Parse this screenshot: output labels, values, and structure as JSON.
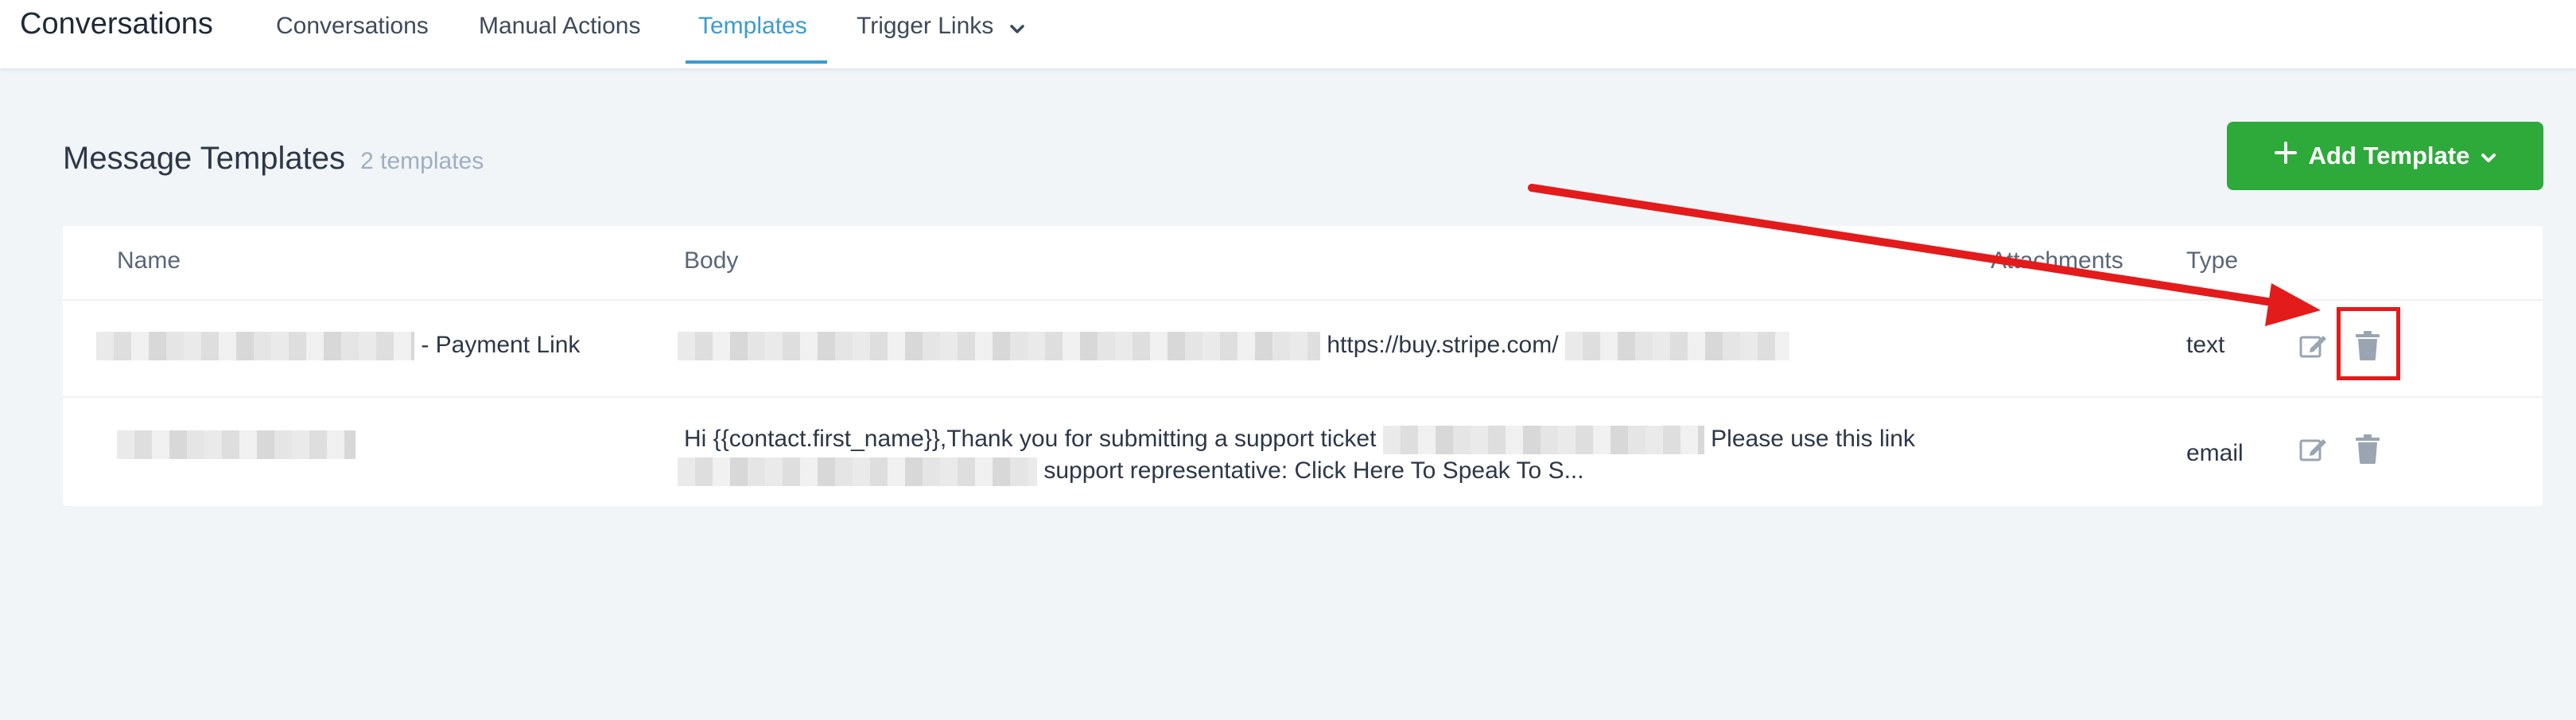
{
  "app": {
    "title": "Conversations"
  },
  "nav": {
    "tabs": [
      {
        "label": "Conversations"
      },
      {
        "label": "Manual Actions"
      },
      {
        "label": "Templates"
      },
      {
        "label": "Trigger Links"
      }
    ]
  },
  "header": {
    "title": "Message Templates",
    "count": "2 templates",
    "add_button": "Add Template"
  },
  "table": {
    "columns": [
      "Name",
      "Body",
      "Attachments",
      "Type"
    ],
    "rows": [
      {
        "name_suffix": "- Payment Link",
        "body_visible": "https://buy.stripe.com/",
        "type": "text"
      },
      {
        "body_line1_start": "Hi {{contact.first_name}},Thank you for submitting a support ticket",
        "body_line1_end": "Please use this link",
        "body_line2_end": "support representative: Click Here To Speak To S...",
        "type": "email"
      }
    ]
  },
  "colors": {
    "accent": "#3a9bd1",
    "add_button": "#2eaa3a",
    "annotation": "#e31b1b"
  },
  "icons": {
    "edit": "pencil-square-icon",
    "delete": "trash-icon",
    "plus": "plus-icon",
    "chevron": "chevron-down-icon"
  }
}
